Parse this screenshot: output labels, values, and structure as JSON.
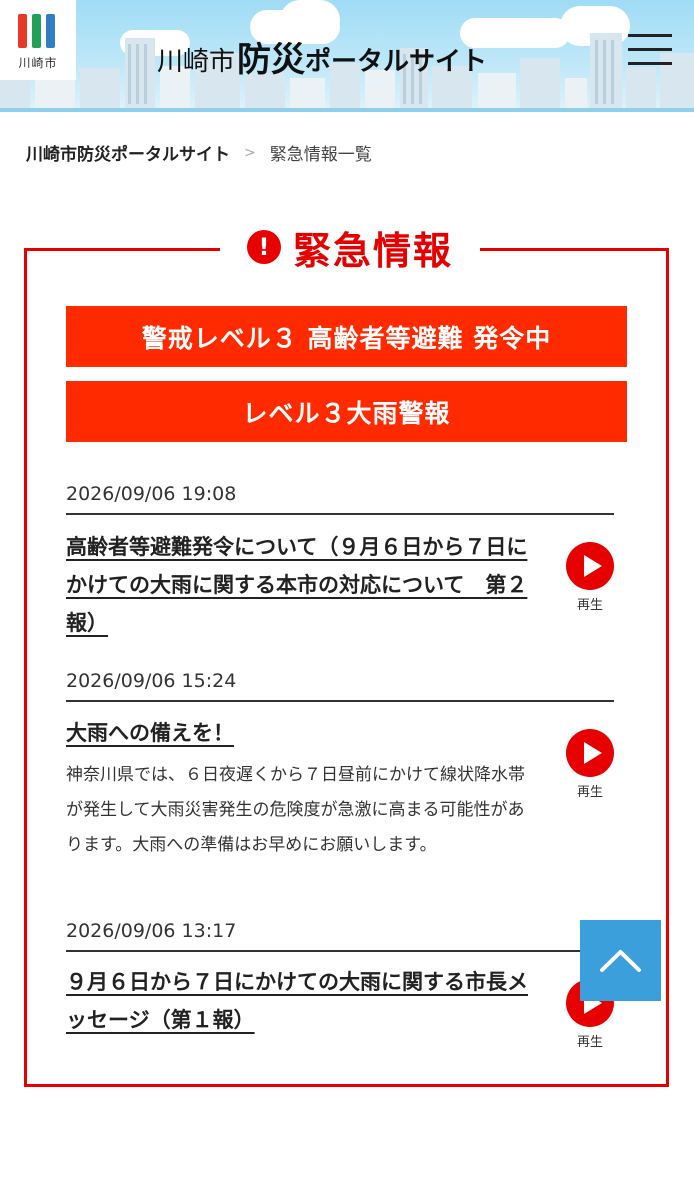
{
  "header": {
    "logo_text": "川崎市",
    "title_city": "川崎市",
    "title_bousai": "防災",
    "title_portal": "ポータルサイト",
    "colors": {
      "sky": "#9fdcf5",
      "logo_red": "#e83828",
      "logo_green": "#22a05a",
      "logo_blue": "#2f7fc1"
    }
  },
  "breadcrumb": {
    "home": "川崎市防災ポータルサイト",
    "separator": ">",
    "current": "緊急情報一覧"
  },
  "panel": {
    "title": "緊急情報",
    "icon": "exclamation-icon",
    "accent": "#e60000",
    "alerts": [
      {
        "label": "警戒レベル３ 高齢者等避難 発令中"
      },
      {
        "label": "レベル３大雨警報"
      }
    ],
    "news": [
      {
        "date": "2026/09/06 19:08",
        "title": "高齢者等避難発令について（９月６日から７日にかけての大雨に関する本市の対応について　第２報）",
        "body": "",
        "play_label": "再生"
      },
      {
        "date": "2026/09/06 15:24",
        "title": "大雨への備えを！",
        "body": "神奈川県では、６日夜遅くから７日昼前にかけて線状降水帯が発生して大雨災害発生の危険度が急激に高まる可能性があります。大雨への準備はお早めにお願いします。",
        "play_label": "再生"
      },
      {
        "date": "2026/09/06 13:17",
        "title": "９月６日から７日にかけての大雨に関する市長メッセージ（第１報）",
        "body": "",
        "play_label": "再生"
      }
    ]
  },
  "back_to_top": {
    "icon": "chevron-up-icon",
    "color": "#3b9fdc"
  }
}
